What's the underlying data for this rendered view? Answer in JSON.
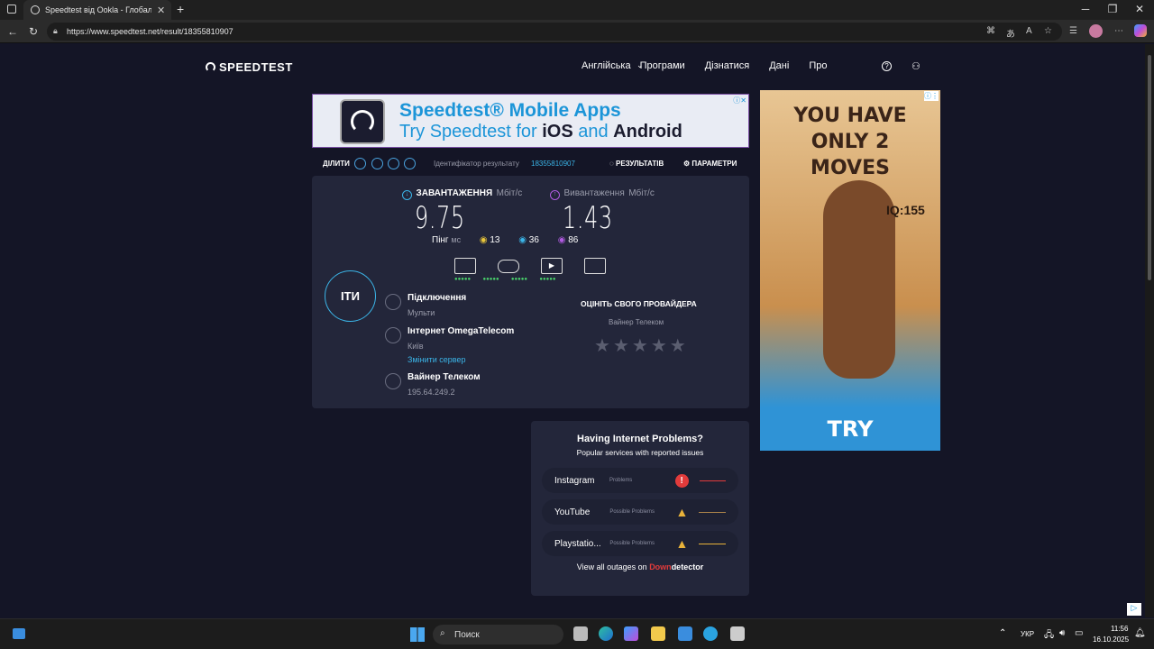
{
  "browser": {
    "tab_title": "Speedtest від Ookla - Глобальни",
    "url": "https://www.speedtest.net/result/18355810907"
  },
  "header": {
    "logo": "SPEEDTEST",
    "nav": [
      "Англійська",
      "Програми",
      "Дізнатися",
      "Дані",
      "Про"
    ]
  },
  "ad_top": {
    "line1": "Speedtest® Mobile Apps",
    "line2_a": "Try Speedtest for ",
    "line2_b": "iOS",
    "line2_c": " and ",
    "line2_d": "Android"
  },
  "share": {
    "label": "ДІЛИТИ",
    "result_id_label": "Ідентифікатор результату",
    "result_id": "18355810907",
    "results_btn": "РЕЗУЛЬТАТІВ",
    "settings_btn": "ПАРАМЕТРИ"
  },
  "download": {
    "label": "ЗАВАНТАЖЕННЯ",
    "unit": "Мбіт/с",
    "value": "9.75"
  },
  "upload": {
    "label": "Вивантаження",
    "unit": "Мбіт/с",
    "value": "1.43"
  },
  "ping": {
    "label": "Пінг",
    "unit": "мс",
    "idle": "13",
    "down": "36",
    "up": "86"
  },
  "go_button": "ІТИ",
  "connection": {
    "label": "Підключення",
    "value": "Мульти"
  },
  "server": {
    "label": "Інтернет OmegaTelecom",
    "city": "Київ",
    "change": "Змінити сервер"
  },
  "provider": {
    "name": "Вайнер Телеком",
    "ip": "195.64.249.2"
  },
  "rate": {
    "title": "ОЦІНІТЬ СВОГО ПРОВАЙДЕРА",
    "provider": "Вайнер Телеком"
  },
  "problems": {
    "title": "Having Internet Problems?",
    "subtitle": "Popular services with reported issues",
    "services": [
      {
        "name": "Instagram",
        "status": "Problems",
        "color": "#e23b3b"
      },
      {
        "name": "YouTube",
        "status": "Possible Problems",
        "color": "#e8b23a"
      },
      {
        "name": "Playstatio...",
        "status": "Possible Problems",
        "color": "#e8b23a"
      }
    ],
    "outages_text": "View all outages on",
    "brand_down": "Down",
    "brand_detector": "detector"
  },
  "ad_side": {
    "headline": "YOU HAVE ONLY 2 MOVES",
    "iq": "IQ:155",
    "cta": "TRY"
  },
  "taskbar": {
    "search": "Поиск",
    "lang": "УКР",
    "time": "11:56",
    "date": "16.10.2025"
  }
}
